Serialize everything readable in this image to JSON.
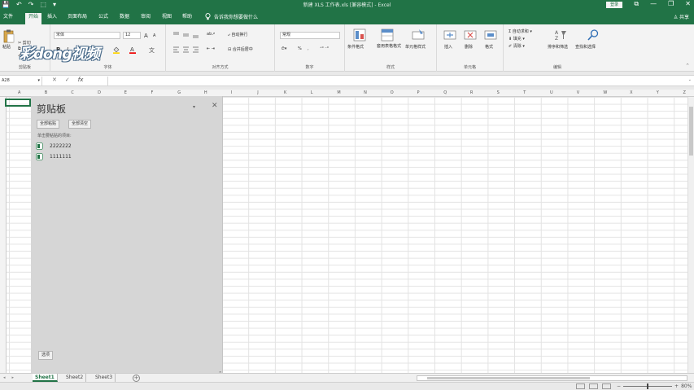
{
  "titlebar": {
    "qat": [
      "💾",
      "↶",
      "↷",
      "⬚",
      "▾"
    ],
    "title": "新建 XLS 工作表.xls [兼容模式] - Excel",
    "login": "登录",
    "winctl": [
      "⧉",
      "—",
      "❐",
      "✕"
    ]
  },
  "tabs": {
    "items": [
      "文件",
      "开始",
      "插入",
      "页面布局",
      "公式",
      "数据",
      "审阅",
      "视图",
      "帮助"
    ],
    "active": "开始",
    "tell_me": "告诉我你想要做什么",
    "share": "共享"
  },
  "ribbon": {
    "watermark": "彩dong视频",
    "clipboard": {
      "paste": "粘贴",
      "cut": "剪切",
      "copy": "复制",
      "format_painter": "格式刷",
      "label": "剪贴板"
    },
    "font": {
      "name": "宋体",
      "size": "12",
      "grow": "A",
      "shrink": "A",
      "bold": "B",
      "italic": "I",
      "underline": "U",
      "label": "字体"
    },
    "alignment": {
      "wrap": "自动换行",
      "merge": "合并后居中",
      "label": "对齐方式"
    },
    "number": {
      "format": "常规",
      "percent": "%",
      "comma": ",",
      "label": "数字"
    },
    "styles": {
      "conditional": "条件格式",
      "table": "套用表格格式",
      "cell": "单元格样式",
      "label": "样式"
    },
    "cells": {
      "insert": "插入",
      "delete": "删除",
      "format": "格式",
      "label": "单元格"
    },
    "editing": {
      "autosum": "自动求和",
      "fill": "填充",
      "clear": "清除",
      "sort": "排序和筛选",
      "find": "查找和选择",
      "label": "编辑"
    }
  },
  "formula_bar": {
    "name_box": "A28",
    "fx": "fx",
    "cancel": "✕",
    "enter": "✓",
    "value": ""
  },
  "columns": [
    "A",
    "B",
    "C",
    "D",
    "E",
    "F",
    "G",
    "H",
    "I",
    "J",
    "K",
    "L",
    "M",
    "N",
    "O",
    "P",
    "Q",
    "R",
    "S",
    "T",
    "U",
    "V",
    "W",
    "X",
    "Y",
    "Z"
  ],
  "clipboard_pane": {
    "title": "剪贴板",
    "paste_all": "全部粘贴",
    "clear_all": "全部清空",
    "hint": "单击要粘贴的项目:",
    "items": [
      "2222222",
      "1111111"
    ],
    "options": "选项"
  },
  "sheets": {
    "tabs": [
      "Sheet1",
      "Sheet2",
      "Sheet3"
    ],
    "active": "Sheet1"
  },
  "status": {
    "zoom": "80%",
    "zoom_fraction": 0.5
  },
  "colors": {
    "brand": "#217346",
    "ribbon": "#f3f3f3",
    "pane": "#d6d6d6"
  }
}
